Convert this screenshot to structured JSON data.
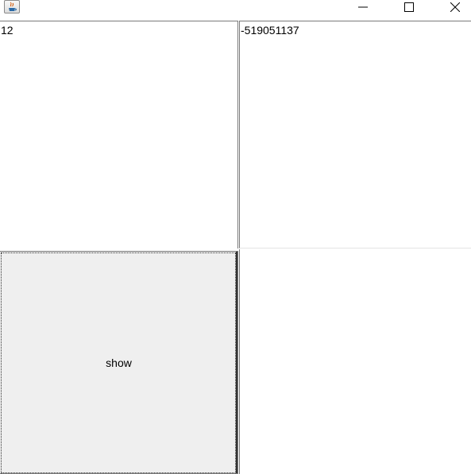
{
  "window": {
    "app_icon": "java-icon",
    "controls": [
      "minimize-icon",
      "maximize-icon",
      "close-icon"
    ]
  },
  "panels": {
    "left_text": "12",
    "right_text": "-519051137"
  },
  "button": {
    "show_label": "show"
  }
}
